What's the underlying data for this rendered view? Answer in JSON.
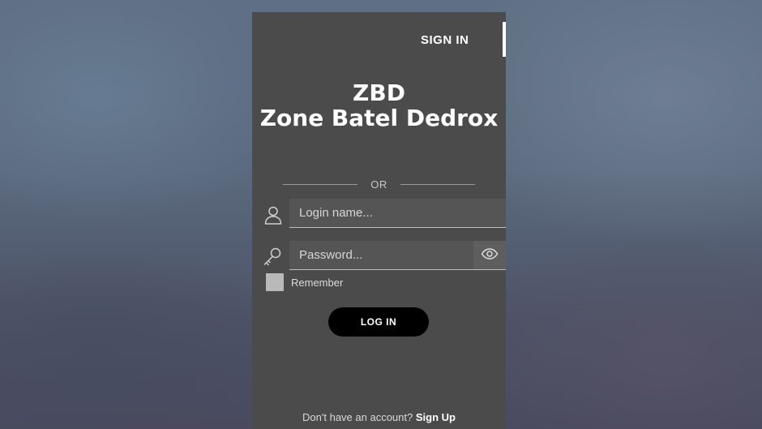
{
  "header": {
    "tab_signin": "SIGN IN"
  },
  "brand": {
    "abbr": "ZBD",
    "name": "Zone Batel Dedrox"
  },
  "divider": {
    "or_text": "OR"
  },
  "form": {
    "login_placeholder": "Login name...",
    "login_value": "",
    "password_placeholder": "Password...",
    "password_value": "",
    "remember_label": "Remember",
    "remember_checked": false,
    "login_button": "LOG IN"
  },
  "footer": {
    "prompt": "Don't have an account?",
    "signup_link": "Sign Up"
  },
  "icons": {
    "user": "user-icon",
    "key": "key-icon",
    "eye": "eye-icon"
  },
  "colors": {
    "panel": "#4b4b4b",
    "button": "#000000",
    "text": "#ffffff",
    "checkbox": "#b9b9b9"
  }
}
